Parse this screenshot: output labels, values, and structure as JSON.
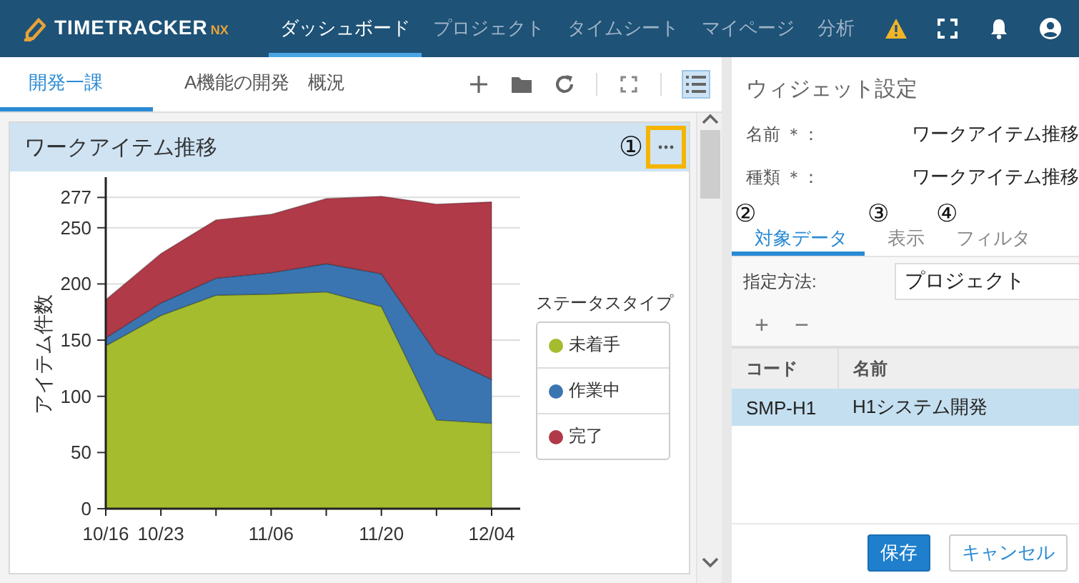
{
  "header": {
    "logo": {
      "text": "TIMETRACKER",
      "suffix": "NX"
    },
    "nav": [
      {
        "label": "ダッシュボード",
        "selected": true
      },
      {
        "label": "プロジェクト",
        "selected": false
      },
      {
        "label": "タイムシート",
        "selected": false
      },
      {
        "label": "マイページ",
        "selected": false
      },
      {
        "label": "分析",
        "selected": false
      }
    ]
  },
  "dashboard": {
    "tabs": [
      {
        "label": "開発一課",
        "selected": true
      },
      {
        "label": "A機能の開発　概況",
        "selected": false
      }
    ],
    "toolbar": {
      "list_view": {
        "selected": true
      }
    },
    "widget": {
      "title": "ワークアイテム推移",
      "annotation": "①",
      "menu_button": {
        "highlighted": true
      },
      "legend_title": "ステータスタイプ",
      "chart_data": {
        "type": "area",
        "stacked": true,
        "ylabel": "アイテム件数",
        "categories": [
          "10/16",
          "10/23",
          null,
          "11/06",
          null,
          "11/20",
          null,
          "12/04"
        ],
        "ylim": [
          0,
          295
        ],
        "grid": true,
        "yticks": [
          0,
          50,
          100,
          150,
          200,
          250,
          277
        ],
        "series": [
          {
            "name": "未着手",
            "color": "#a4bc2e",
            "values": [
              145,
              172,
              190,
              191,
              193,
              180,
              79,
              76
            ]
          },
          {
            "name": "作業中",
            "color": "#3a75b2",
            "values": [
              7,
              11,
              15,
              19,
              25,
              29,
              59,
              39
            ]
          },
          {
            "name": "完了",
            "color": "#b03a48",
            "values": [
              34,
              44,
              52,
              52,
              58,
              69,
              133,
              158
            ]
          }
        ]
      }
    }
  },
  "settings": {
    "title": "ウィジェット設定",
    "fields": [
      {
        "label": "名前 ＊：",
        "value": "ワークアイテム推移"
      },
      {
        "label": "種類 ＊：",
        "value": "ワークアイテム推移"
      }
    ],
    "tabs": [
      {
        "annotation": "②",
        "label": "対象データ",
        "selected": true
      },
      {
        "annotation": "③",
        "label": "表示",
        "selected": false
      },
      {
        "annotation": "④",
        "label": "フィルタ",
        "selected": false
      }
    ],
    "method": {
      "label": "指定方法:",
      "value": "プロジェクト"
    },
    "row_actions": [
      "+",
      "−"
    ],
    "table": {
      "columns": [
        "コード",
        "名前"
      ],
      "rows": [
        {
          "cells": [
            "SMP-H1",
            "H1システム開発"
          ],
          "selected": true
        }
      ]
    },
    "buttons": [
      {
        "label": "保存",
        "kind": "primary"
      },
      {
        "label": "キャンセル",
        "kind": "secondary"
      }
    ]
  }
}
